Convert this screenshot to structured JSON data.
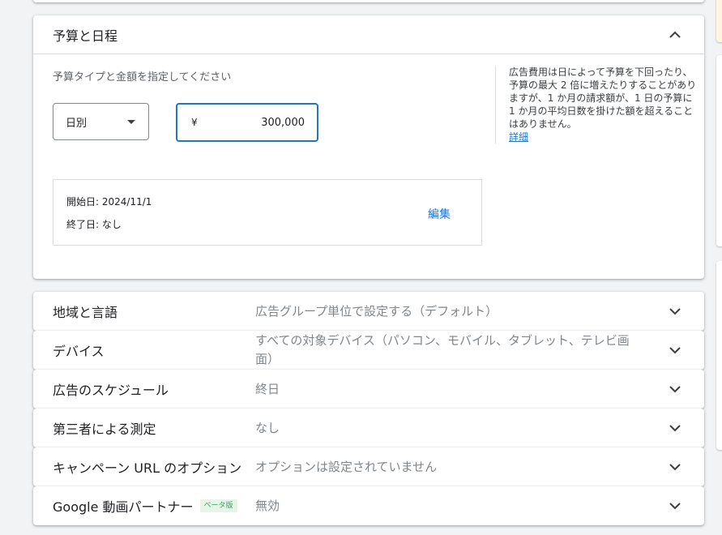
{
  "budget": {
    "title": "予算と日程",
    "instructions": "予算タイプと金額を指定してください",
    "type_select": "日別",
    "currency_symbol": "¥",
    "amount": "300,000",
    "side_note": "広告費用は日によって予算を下回ったり、予算の最大 2 倍に増えたりすることがありますが、1 か月の請求額が、1 日の予算に 1 か月の平均日数を掛けた額を超えることはありません。",
    "side_note_link": "詳細",
    "start_date": "開始日: 2024/11/1",
    "end_date": "終了日: なし",
    "edit_label": "編集"
  },
  "settings": [
    {
      "label": "地域と言語",
      "value": "広告グループ単位で設定する（デフォルト）"
    },
    {
      "label": "デバイス",
      "value": "すべての対象デバイス（パソコン、モバイル、タブレット、テレビ画面）"
    },
    {
      "label": "広告のスケジュール",
      "value": "終日"
    },
    {
      "label": "第三者による測定",
      "value": "なし"
    },
    {
      "label": "キャンペーン URL のオプション",
      "value": "オプションは設定されていません"
    },
    {
      "label": "Google 動画パートナー",
      "badge": "ベータ版",
      "value": "無効"
    }
  ],
  "colors": {
    "accent": "#1a73e8",
    "badge_bg": "#e6f4ea",
    "badge_text": "#34a853"
  },
  "icons": {
    "collapse": "chevron-up-icon",
    "expand": "chevron-down-icon",
    "dropdown": "caret-down-icon"
  }
}
